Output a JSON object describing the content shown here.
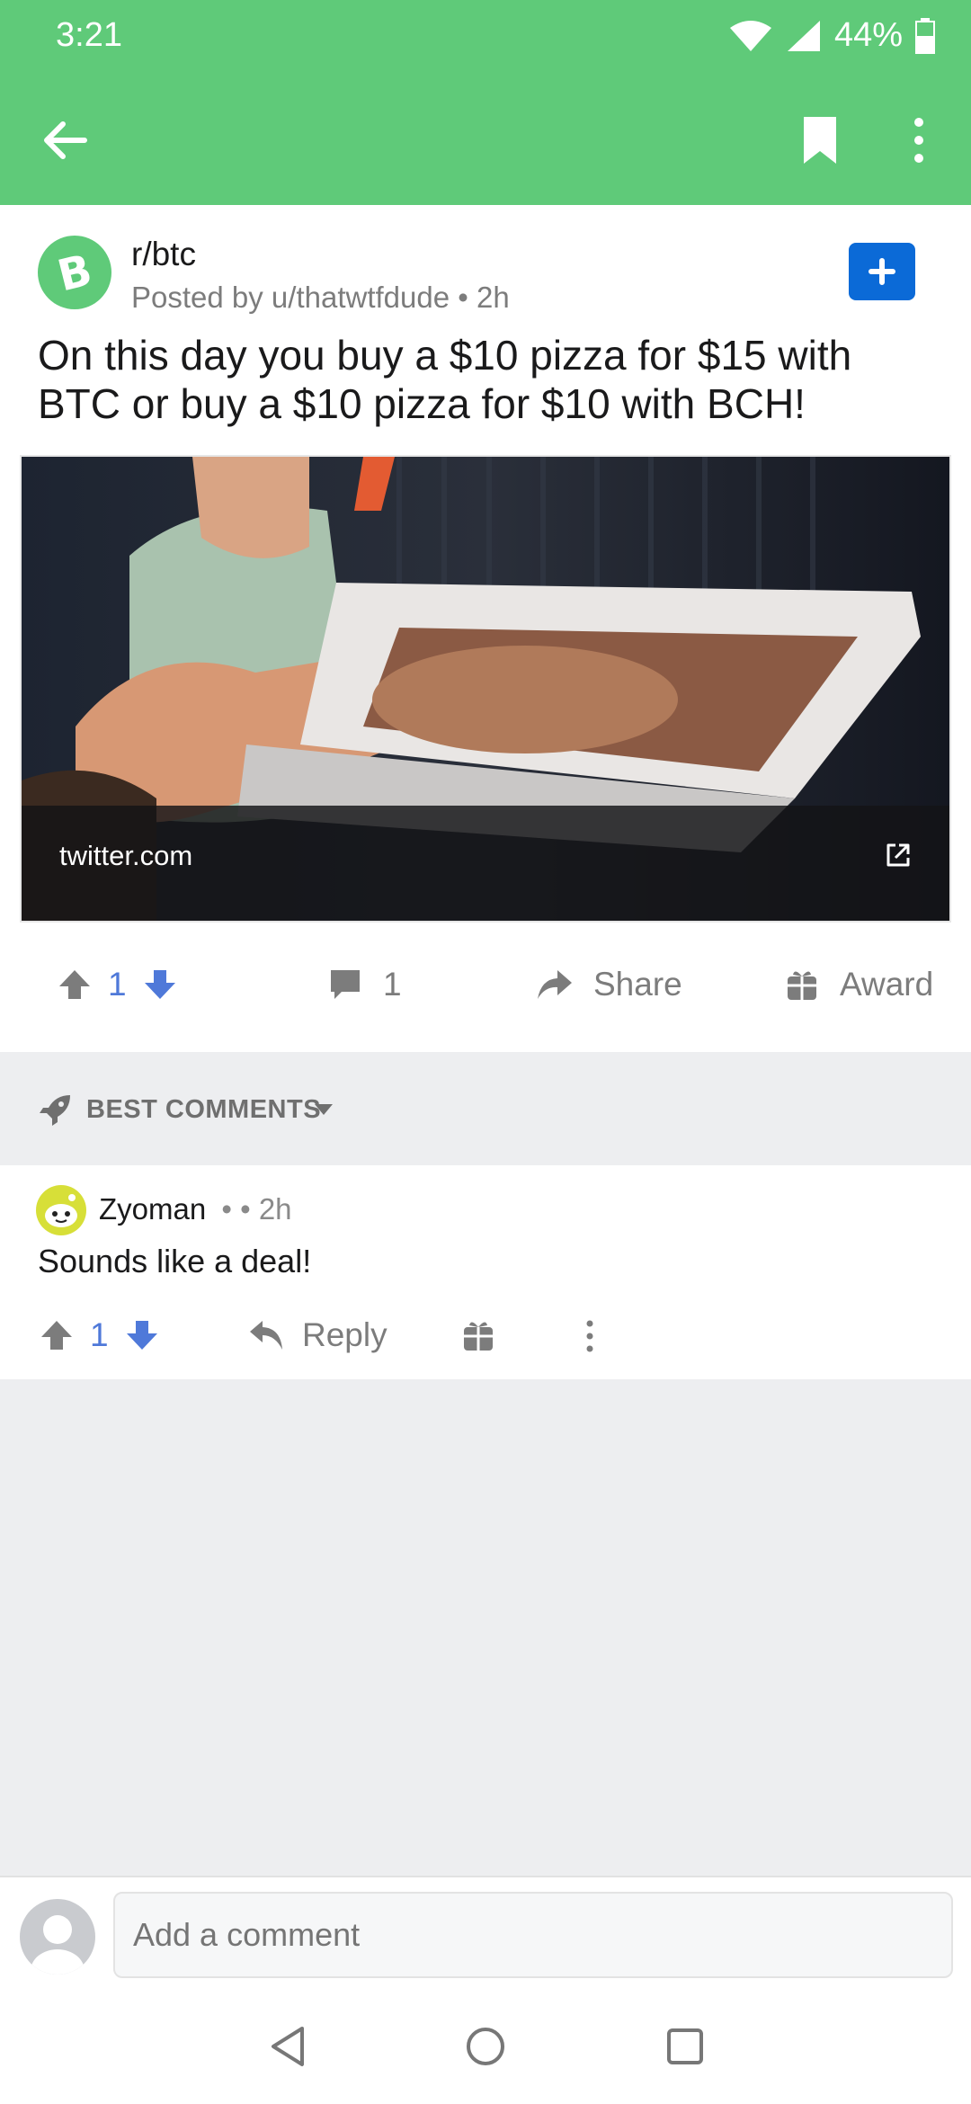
{
  "status_bar": {
    "time": "3:21",
    "battery": "44%"
  },
  "post": {
    "subreddit": "r/btc",
    "posted_by": "Posted by u/thatwtfdude • 2h",
    "title": "On this day you buy a $10 pizza for $15 with BTC or buy a $10 pizza for $10 with BCH!",
    "link_domain": "twitter.com",
    "votes": "1",
    "comment_count": "1",
    "share_label": "Share",
    "award_label": "Award"
  },
  "comments_sort": {
    "label": "BEST COMMENTS"
  },
  "comments": [
    {
      "author": "Zyoman",
      "meta": "• • 2h",
      "body": "Sounds like a deal!",
      "votes": "1",
      "reply_label": "Reply"
    }
  ],
  "composer": {
    "placeholder": "Add a comment"
  },
  "colors": {
    "brand": "#5fca79",
    "upvote": "#4f79d9",
    "join": "#0b6ad7"
  }
}
